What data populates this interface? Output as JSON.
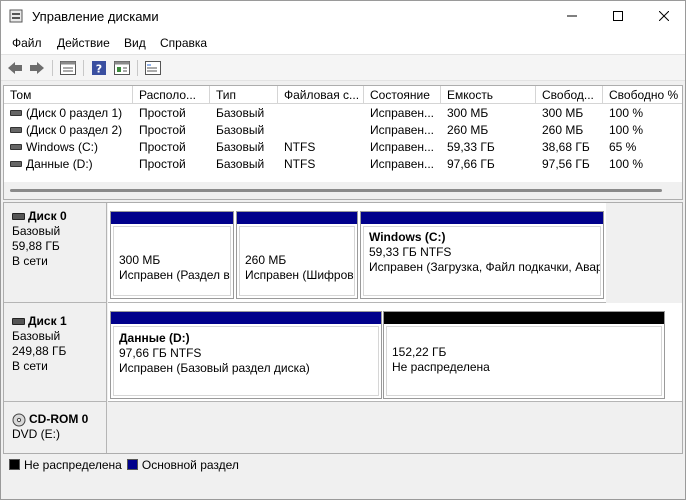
{
  "window": {
    "title": "Управление дисками"
  },
  "menu": [
    "Файл",
    "Действие",
    "Вид",
    "Справка"
  ],
  "toolbar": {
    "icons": [
      "back-arrow-icon",
      "forward-arrow-icon",
      "list-view-icon",
      "help-icon",
      "properties-icon",
      "console-icon"
    ]
  },
  "table": {
    "columns": [
      "Том",
      "Располо...",
      "Тип",
      "Файловая с...",
      "Состояние",
      "Емкость",
      "Свобод...",
      "Свободно %"
    ],
    "rows": [
      [
        "(Диск 0 раздел 1)",
        "Простой",
        "Базовый",
        "",
        "Исправен...",
        "300 МБ",
        "300 МБ",
        "100 %"
      ],
      [
        "(Диск 0 раздел 2)",
        "Простой",
        "Базовый",
        "",
        "Исправен...",
        "260 МБ",
        "260 МБ",
        "100 %"
      ],
      [
        "Windows (C:)",
        "Простой",
        "Базовый",
        "NTFS",
        "Исправен...",
        "59,33 ГБ",
        "38,68 ГБ",
        "65 %"
      ],
      [
        "Данные (D:)",
        "Простой",
        "Базовый",
        "NTFS",
        "Исправен...",
        "97,66 ГБ",
        "97,56 ГБ",
        "100 %"
      ]
    ]
  },
  "disks": [
    {
      "name": "Диск 0",
      "type": "Базовый",
      "size": "59,88 ГБ",
      "status": "В сети",
      "partitions": [
        {
          "name": "",
          "size": "300 МБ",
          "status": "Исправен (Раздел во"
        },
        {
          "name": "",
          "size": "260 МБ",
          "status": "Исправен (Шифров"
        },
        {
          "name": "Windows  (C:)",
          "size": "59,33 ГБ NTFS",
          "status": "Исправен (Загрузка, Файл подкачки, Авар"
        }
      ]
    },
    {
      "name": "Диск 1",
      "type": "Базовый",
      "size": "249,88 ГБ",
      "status": "В сети",
      "partitions": [
        {
          "name": "Данные  (D:)",
          "size": "97,66 ГБ NTFS",
          "status": "Исправен (Базовый раздел диска)"
        },
        {
          "name": "",
          "size": "152,22 ГБ",
          "status": "Не распределена"
        }
      ]
    },
    {
      "name": "CD-ROM 0",
      "type": "DVD (E:)"
    }
  ],
  "legend": {
    "unallocated": "Не распределена",
    "primary": "Основной раздел"
  },
  "colors": {
    "primary": "#00008b",
    "unallocated": "#000000"
  }
}
